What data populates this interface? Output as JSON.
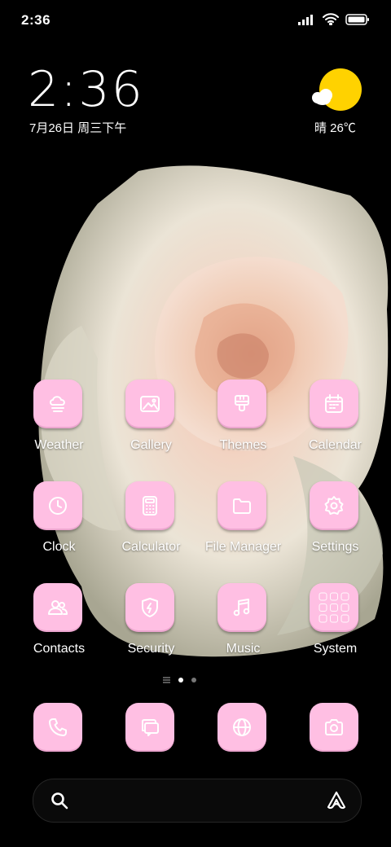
{
  "status_bar": {
    "time": "2:36",
    "icons": [
      "signal-icon",
      "wifi-icon",
      "battery-icon"
    ]
  },
  "lock_widget": {
    "clock": "2:36",
    "date": "7月26日 周三下午",
    "weather": "晴 26℃",
    "weather_icon": "sun-cloud-icon"
  },
  "apps": [
    {
      "label": "Weather",
      "icon": "weather-icon"
    },
    {
      "label": "Gallery",
      "icon": "gallery-icon"
    },
    {
      "label": "Themes",
      "icon": "brush-icon"
    },
    {
      "label": "Calendar",
      "icon": "calendar-icon"
    },
    {
      "label": "Clock",
      "icon": "clock-icon"
    },
    {
      "label": "Calculator",
      "icon": "calculator-icon"
    },
    {
      "label": "File Manager",
      "icon": "folder-icon"
    },
    {
      "label": "Settings",
      "icon": "gear-icon"
    },
    {
      "label": "Contacts",
      "icon": "contacts-icon"
    },
    {
      "label": "Security",
      "icon": "shield-icon"
    },
    {
      "label": "Music",
      "icon": "music-icon"
    },
    {
      "label": "System",
      "icon": "folder-grid-icon"
    }
  ],
  "dock": [
    {
      "icon": "phone-icon"
    },
    {
      "icon": "messages-icon"
    },
    {
      "icon": "browser-icon"
    },
    {
      "icon": "camera-icon"
    }
  ],
  "page_indicator": {
    "pages": 2,
    "current": 1
  },
  "search_bar": {
    "left_icon": "search-icon",
    "right_icon": "assistant-icon"
  },
  "colors": {
    "tile": "#ffbfe3",
    "background": "#000000",
    "text": "#ffffff"
  }
}
